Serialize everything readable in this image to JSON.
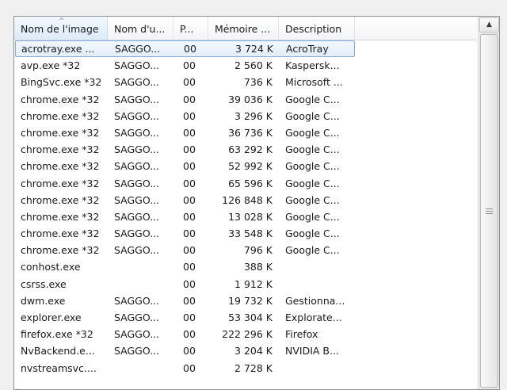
{
  "columns": {
    "name": "Nom de l'image",
    "user": "Nom d'u...",
    "priority": "P...",
    "memory": "Mémoire ...",
    "description": "Description"
  },
  "processes": [
    {
      "name": "acrotray.exe ...",
      "user": "SAGGO...",
      "priority": "00",
      "memory": "3 724 K",
      "description": "AcroTray"
    },
    {
      "name": "avp.exe *32",
      "user": "SAGGO...",
      "priority": "00",
      "memory": "2 560 K",
      "description": "Kaspersk..."
    },
    {
      "name": "BingSvc.exe *32",
      "user": "SAGGO...",
      "priority": "00",
      "memory": "736 K",
      "description": "Microsoft ..."
    },
    {
      "name": "chrome.exe *32",
      "user": "SAGGO...",
      "priority": "00",
      "memory": "39 036 K",
      "description": "Google C..."
    },
    {
      "name": "chrome.exe *32",
      "user": "SAGGO...",
      "priority": "00",
      "memory": "3 296 K",
      "description": "Google C..."
    },
    {
      "name": "chrome.exe *32",
      "user": "SAGGO...",
      "priority": "00",
      "memory": "36 736 K",
      "description": "Google C..."
    },
    {
      "name": "chrome.exe *32",
      "user": "SAGGO...",
      "priority": "00",
      "memory": "63 292 K",
      "description": "Google C..."
    },
    {
      "name": "chrome.exe *32",
      "user": "SAGGO...",
      "priority": "00",
      "memory": "52 992 K",
      "description": "Google C..."
    },
    {
      "name": "chrome.exe *32",
      "user": "SAGGO...",
      "priority": "00",
      "memory": "65 596 K",
      "description": "Google C..."
    },
    {
      "name": "chrome.exe *32",
      "user": "SAGGO...",
      "priority": "00",
      "memory": "126 848 K",
      "description": "Google C..."
    },
    {
      "name": "chrome.exe *32",
      "user": "SAGGO...",
      "priority": "00",
      "memory": "13 028 K",
      "description": "Google C..."
    },
    {
      "name": "chrome.exe *32",
      "user": "SAGGO...",
      "priority": "00",
      "memory": "33 548 K",
      "description": "Google C..."
    },
    {
      "name": "chrome.exe *32",
      "user": "SAGGO...",
      "priority": "00",
      "memory": "796 K",
      "description": "Google C..."
    },
    {
      "name": "conhost.exe",
      "user": "",
      "priority": "00",
      "memory": "388 K",
      "description": ""
    },
    {
      "name": "csrss.exe",
      "user": "",
      "priority": "00",
      "memory": "1 912 K",
      "description": ""
    },
    {
      "name": "dwm.exe",
      "user": "SAGGO...",
      "priority": "00",
      "memory": "19 732 K",
      "description": "Gestionna..."
    },
    {
      "name": "explorer.exe",
      "user": "SAGGO...",
      "priority": "00",
      "memory": "53 304 K",
      "description": "Explorate..."
    },
    {
      "name": "firefox.exe *32",
      "user": "SAGGO...",
      "priority": "00",
      "memory": "222 296 K",
      "description": "Firefox"
    },
    {
      "name": "NvBackend.e...",
      "user": "SAGGO...",
      "priority": "00",
      "memory": "3 204 K",
      "description": "NVIDIA B..."
    },
    {
      "name": "nvstreamsvc....",
      "user": "",
      "priority": "00",
      "memory": "2 728 K",
      "description": ""
    }
  ]
}
